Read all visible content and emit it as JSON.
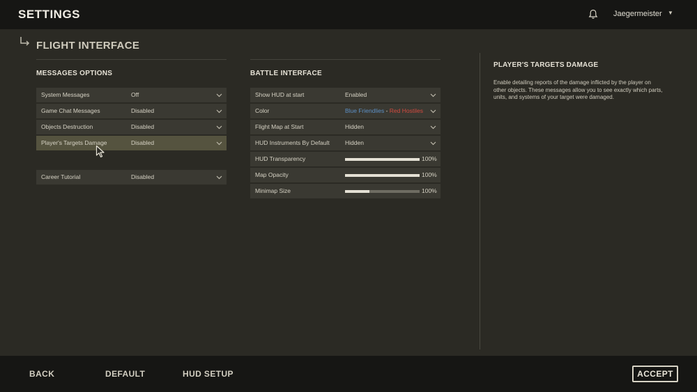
{
  "header": {
    "title": "SETTINGS",
    "username": "Jaegermeister"
  },
  "page": {
    "title": "FLIGHT INTERFACE"
  },
  "messages_options": {
    "title": "MESSAGES OPTIONS",
    "rows": [
      {
        "label": "System Messages",
        "value": "Off"
      },
      {
        "label": "Game Chat Messages",
        "value": "Disabled"
      },
      {
        "label": "Objects Destruction",
        "value": "Disabled"
      },
      {
        "label": "Player's Targets Damage",
        "value": "Disabled"
      },
      {
        "label": "Career Tutorial",
        "value": "Disabled"
      }
    ]
  },
  "battle_interface": {
    "title": "BATTLE INTERFACE",
    "rows": [
      {
        "label": "Show HUD at start",
        "value": "Enabled"
      },
      {
        "label": "Color",
        "value_blue": "Blue Friendlies",
        "value_sep": " - ",
        "value_red": "Red Hostiles"
      },
      {
        "label": "Flight Map at Start",
        "value": "Hidden"
      },
      {
        "label": "HUD Instruments By Default",
        "value": "Hidden"
      }
    ],
    "sliders": [
      {
        "label": "HUD Transparency",
        "value_text": "100%",
        "fill": 1.0
      },
      {
        "label": "Map Opacity",
        "value_text": "100%",
        "fill": 1.0
      },
      {
        "label": "Minimap Size",
        "value_text": "100%",
        "fill": 0.33
      }
    ]
  },
  "info_panel": {
    "title": "PLAYER'S TARGETS DAMAGE",
    "description": "Enable detailing reports of the damage inflicted by the player on other objects. These messages allow you to see exactly which parts, units, and systems of your target were damaged."
  },
  "footer": {
    "back": "BACK",
    "default": "DEFAULT",
    "hud_setup": "HUD SETUP",
    "accept": "ACCEPT"
  },
  "colors": {
    "friendly_blue": "#5c8fc4",
    "hostile_red": "#d24a3f",
    "highlight_row": "#55533f"
  }
}
